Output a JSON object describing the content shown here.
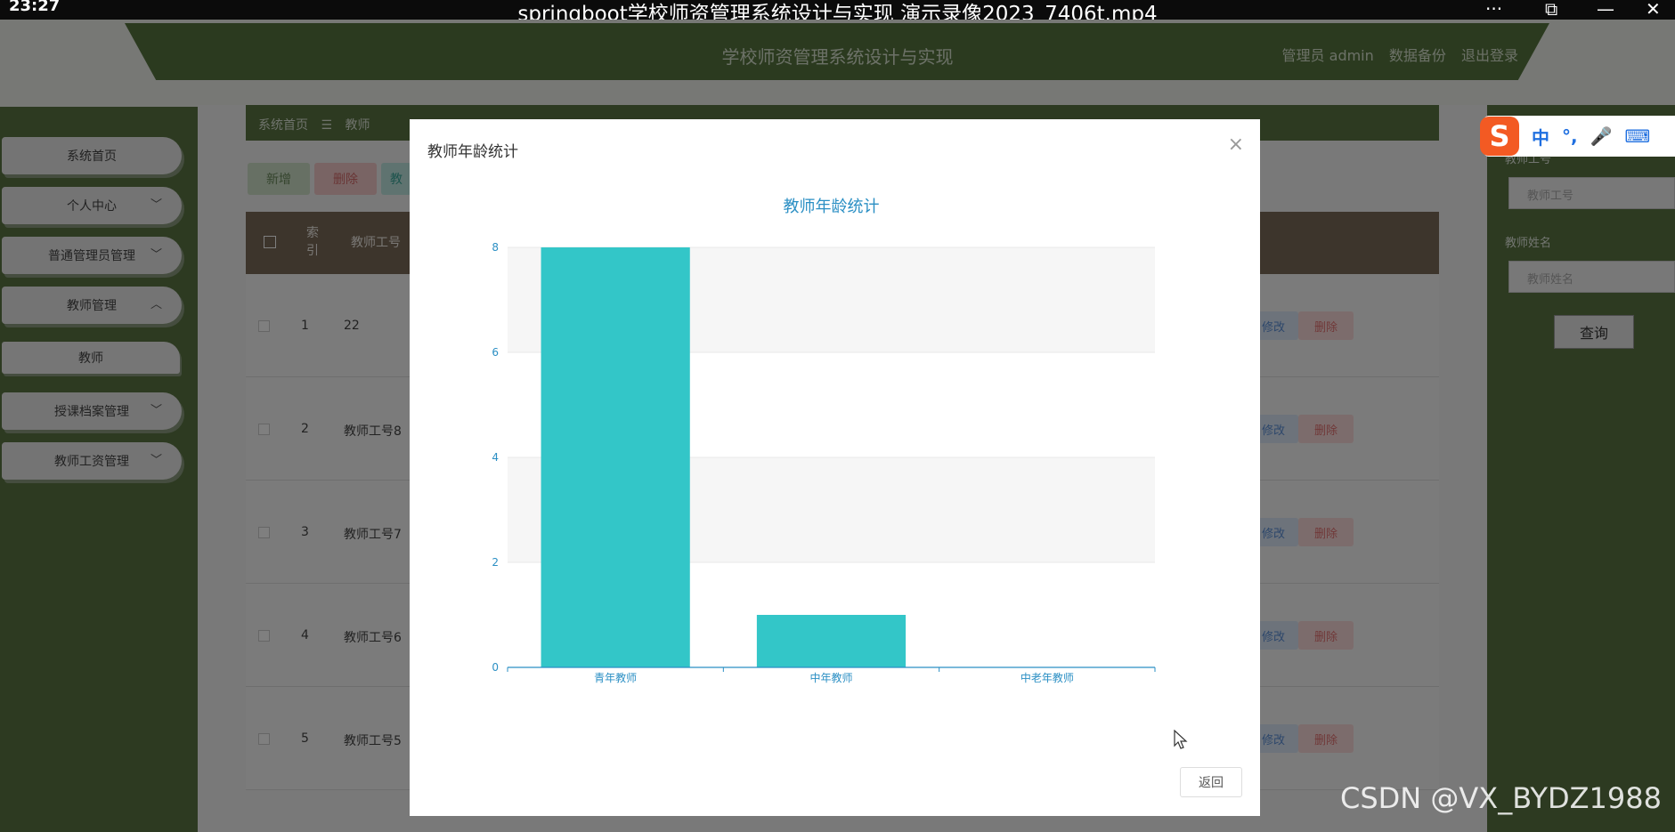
{
  "player": {
    "time": "23:27",
    "title": "springboot学校师资管理系统设计与实现 演示录像2023_7406t.mp4",
    "controls": [
      "···",
      "⧉",
      "—",
      "✕"
    ]
  },
  "header": {
    "title": "学校师资管理系统设计与实现",
    "user": "管理员 admin",
    "backup": "数据备份",
    "logout": "退出登录"
  },
  "sidebar": {
    "items": [
      {
        "label": "系统首页",
        "chevron": ""
      },
      {
        "label": "个人中心",
        "chevron": "﹀"
      },
      {
        "label": "普通管理员管理",
        "chevron": "﹀"
      },
      {
        "label": "教师管理",
        "chevron": "︿"
      },
      {
        "label": "教师",
        "chevron": ""
      },
      {
        "label": "授课档案管理",
        "chevron": "﹀"
      },
      {
        "label": "教师工资管理",
        "chevron": "﹀"
      }
    ]
  },
  "breadcrumb": {
    "home": "系统首页",
    "sep": "☰",
    "current": "教师"
  },
  "toolbar": {
    "add": "新增",
    "delete": "删除",
    "stat": "教"
  },
  "table": {
    "headers": {
      "index": "索引",
      "code": "教师工号"
    },
    "rows": [
      {
        "index": "1",
        "code": "22",
        "edit": "修改",
        "delete": "删除"
      },
      {
        "index": "2",
        "code": "教师工号8",
        "edit": "修改",
        "delete": "删除"
      },
      {
        "index": "3",
        "code": "教师工号7",
        "edit": "修改",
        "delete": "删除"
      },
      {
        "index": "4",
        "code": "教师工号6",
        "edit": "修改",
        "delete": "删除"
      },
      {
        "index": "5",
        "code": "教师工号5",
        "edit": "修改",
        "delete": "删除"
      }
    ]
  },
  "search": {
    "code_label": "教师工号",
    "code_placeholder": "教师工号",
    "name_label": "教师姓名",
    "name_placeholder": "教师姓名",
    "button": "查询"
  },
  "ime": {
    "logo": "S",
    "items": [
      "中",
      "°,",
      "🎤",
      "⌨"
    ]
  },
  "modal": {
    "title": "教师年龄统计",
    "close": "×",
    "back": "返回"
  },
  "chart_data": {
    "type": "bar",
    "title": "教师年龄统计",
    "categories": [
      "青年教师",
      "中年教师",
      "中老年教师"
    ],
    "values": [
      8,
      1,
      0
    ],
    "yticks": [
      0,
      2,
      4,
      6,
      8
    ],
    "ylim": [
      0,
      8
    ],
    "xlabel": "",
    "ylabel": "",
    "bar_color": "#33c6c8",
    "axis_color": "#2b8fc4",
    "band_color": "#f6f6f6",
    "grid": true
  },
  "watermark": "CSDN @VX_BYDZ1988"
}
